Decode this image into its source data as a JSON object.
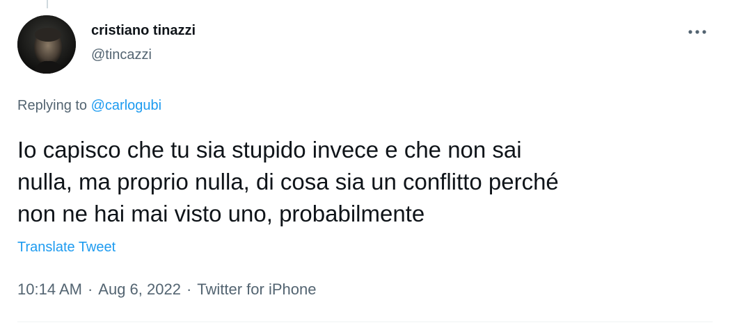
{
  "tweet": {
    "author_name": "cristiano tinazzi",
    "author_handle": "@tincazzi",
    "replying_prefix": "Replying to ",
    "replying_to": "@carlogubi",
    "text": "Io capisco che tu sia stupido invece e che non sai\nnulla, ma proprio nulla, di cosa sia un conflitto perché\nnon ne hai mai visto uno, probabilmente",
    "translate_label": "Translate Tweet",
    "time": "10:14 AM",
    "date": "Aug 6, 2022",
    "source": "Twitter for iPhone",
    "separator": "·"
  },
  "icons": {
    "more": "more-horizontal-icon",
    "avatar": "avatar"
  },
  "colors": {
    "accent": "#1d9bf0",
    "secondary_text": "#536471",
    "primary_text": "#0f1419"
  }
}
